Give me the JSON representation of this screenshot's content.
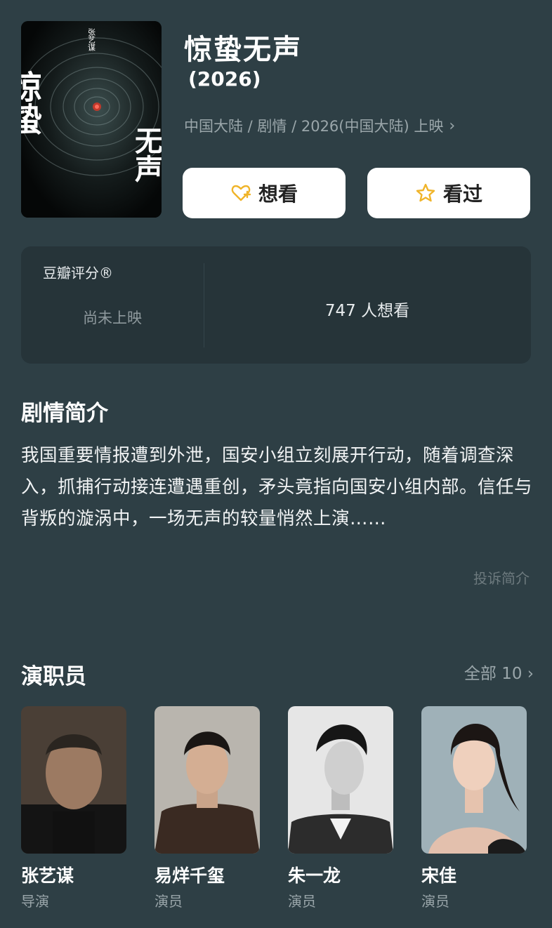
{
  "movie": {
    "title": "惊蛰无声",
    "year": "(2026)",
    "meta": "中国大陆 / 剧情 / 2026(中国大陆) 上映",
    "poster_text": {
      "title_left": "惊蛰",
      "title_right": "无声",
      "director_credit": "张艺谋"
    }
  },
  "actions": {
    "want_label": "想看",
    "seen_label": "看过",
    "accent_color": "#f0b429"
  },
  "rating": {
    "label": "豆瓣评分®",
    "status": "尚未上映",
    "want_count": "747 人想看"
  },
  "plot": {
    "heading": "剧情简介",
    "text": "我国重要情报遭到外泄，国安小组立刻展开行动，随着调查深入，抓捕行动接连遭遇重创，矛头竟指向国安小组内部。信任与背叛的漩涡中，一场无声的较量悄然上演……",
    "report_label": "投诉简介"
  },
  "cast": {
    "heading": "演职员",
    "all_label": "全部 10",
    "members": [
      {
        "name": "张艺谋",
        "role": "导演"
      },
      {
        "name": "易烊千玺",
        "role": "演员"
      },
      {
        "name": "朱一龙",
        "role": "演员"
      },
      {
        "name": "宋佳",
        "role": "演员"
      }
    ]
  }
}
